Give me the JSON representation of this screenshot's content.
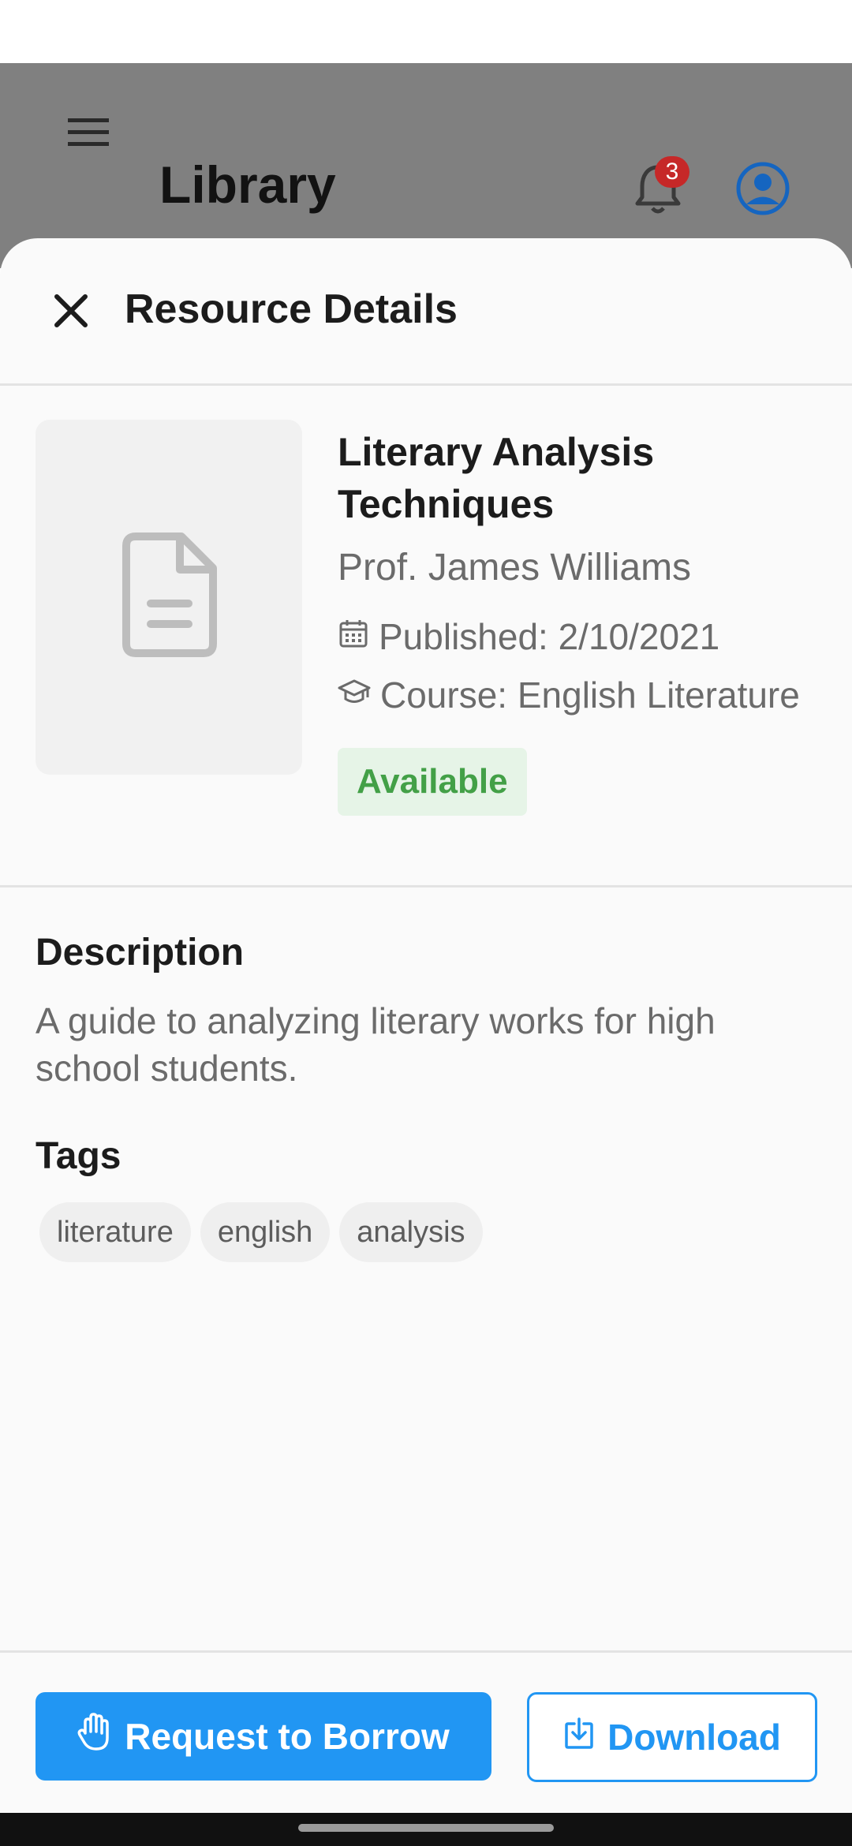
{
  "app": {
    "title": "Library",
    "notification_count": "3",
    "accent_color": "#2196f3"
  },
  "sheet": {
    "title": "Resource Details",
    "resource": {
      "title": "Literary Analysis Techniques",
      "author": "Prof. James Williams",
      "published": "Published: 2/10/2021",
      "course": "Course: English Literature",
      "status": "Available",
      "status_color": "#43a047"
    },
    "description_heading": "Description",
    "description": "A guide to analyzing literary works for high school students.",
    "tags_heading": "Tags",
    "tags": [
      "literature",
      "english",
      "analysis"
    ]
  },
  "actions": {
    "borrow_label": "Request to Borrow",
    "download_label": "Download"
  },
  "icons": [
    "menu-icon",
    "bell-icon",
    "account-icon",
    "close-icon",
    "document-icon",
    "calendar-icon",
    "graduation-cap-icon",
    "hand-icon",
    "download-icon"
  ]
}
